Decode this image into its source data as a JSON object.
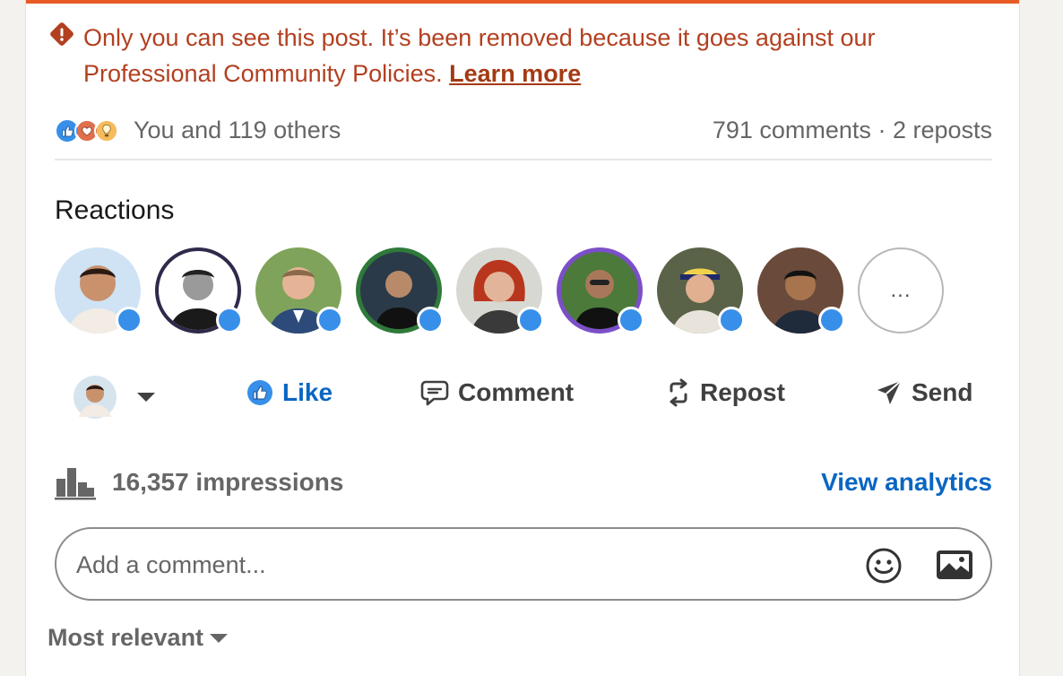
{
  "notice": {
    "text": "Only you can see this post. It’s been removed because it goes against our Professional Community Policies. ",
    "link_label": "Learn more"
  },
  "social_counts": {
    "reactions_label": "You and 119 others",
    "comments_label": "791 comments",
    "separator": " · ",
    "reposts_label": "2 reposts"
  },
  "reactions": {
    "title": "Reactions",
    "avatar_count": 8,
    "more_label": "..."
  },
  "actions": {
    "like": "Like",
    "comment": "Comment",
    "repost": "Repost",
    "send": "Send"
  },
  "analytics": {
    "impressions": "16,357 impressions",
    "link_label": "View analytics"
  },
  "comment_box": {
    "placeholder": "Add a comment..."
  },
  "sort": {
    "label": "Most relevant"
  },
  "colors": {
    "warning": "#b24020",
    "accent": "#0a66c2",
    "like_badge": "#378fe9",
    "top_border": "#e85a25"
  }
}
